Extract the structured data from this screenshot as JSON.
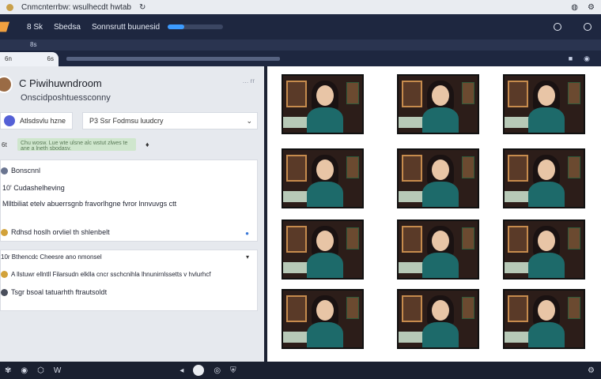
{
  "titlebar": {
    "title": "Cnmcnterrbw: wsulhecdt hwtab",
    "right_icons": [
      "refresh-icon",
      "settings-icon"
    ]
  },
  "topbar": {
    "item1": "8 Sk",
    "item2": "Sbedsa",
    "item3": "Sonnsrutt buunesid",
    "progress_fraction": 0.3
  },
  "subbar": {
    "label": "8s"
  },
  "tab": {
    "label": "6n",
    "badge": "6s"
  },
  "header": {
    "name": "C Piwihuwndroom",
    "subtitle": "Onscidposhtuessconny",
    "options": "… rr"
  },
  "chips": {
    "left_label": "Atlsdsvlu hzne",
    "search_placeholder": "P3 Ssr Fodmsu luudcry"
  },
  "notice": {
    "label": "6t",
    "text": "Chu wosw. Lue wte ulsne alc wstut zlwes te ane a lneth sbodasv."
  },
  "card1": {
    "title": "Bonscnnl",
    "line1": "10' Cudashelheving",
    "line2": "Mlltbiliat etelv abuerrsgnb fravorlhgne fvror lnnvuvgs ctt",
    "line3": "Rdhsd hoslh orvliel th shlenbelt"
  },
  "card2": {
    "title": "10r Bthencdc Cheesre ano nmonsel",
    "line1": "A llstuwr ellntll Filarsudn elklla cncr sschcnihla lhnunirnlssetts v hvlurhcf",
    "line2": "Tsgr bsoal tatuarhth ftrautsoldt"
  },
  "thumbnails": [
    {
      "name": "participant-1"
    },
    {
      "name": "participant-2"
    },
    {
      "name": "participant-3"
    },
    {
      "name": "participant-4"
    },
    {
      "name": "participant-5"
    },
    {
      "name": "participant-6"
    },
    {
      "name": "participant-7"
    },
    {
      "name": "participant-8"
    },
    {
      "name": "participant-9"
    },
    {
      "name": "participant-10"
    },
    {
      "name": "participant-11"
    },
    {
      "name": "participant-12"
    }
  ],
  "colors": {
    "topbar_bg": "#1e2740",
    "accent_blue": "#3c9bff",
    "teal_shirt": "#1d6a6a"
  }
}
